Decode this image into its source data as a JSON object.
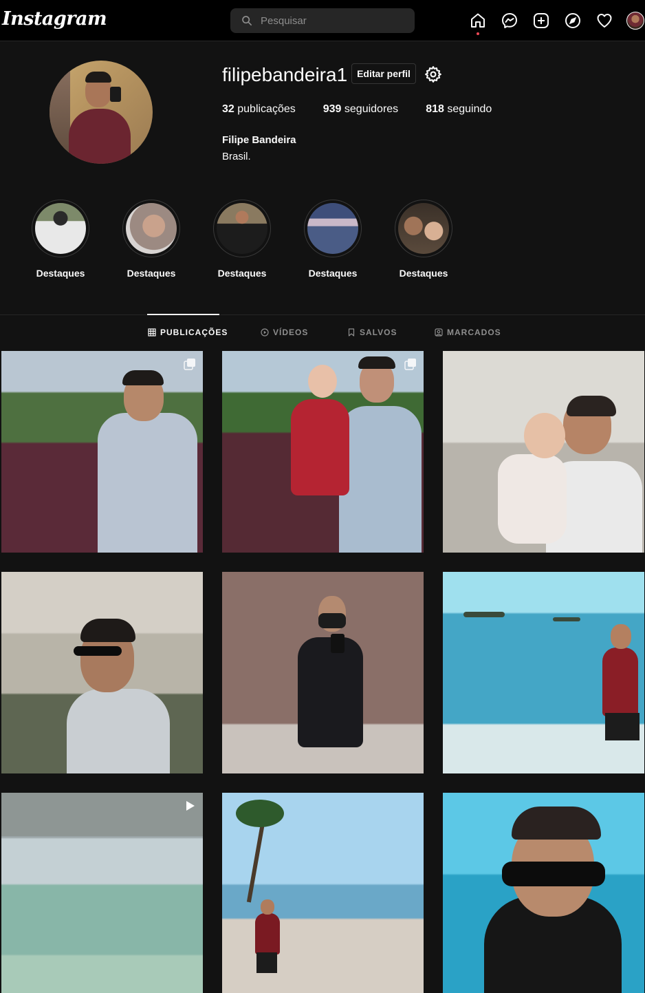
{
  "topbar": {
    "logo": "Instagram",
    "search_placeholder": "Pesquisar",
    "icons": [
      "home-icon",
      "messenger-icon",
      "new-post-icon",
      "explore-icon",
      "activity-heart-icon",
      "profile-avatar"
    ]
  },
  "profile": {
    "username": "filipebandeira1",
    "edit_label": "Editar perfil",
    "posts_count": "32",
    "posts_label": "publicações",
    "followers_count": "939",
    "followers_label": "seguidores",
    "following_count": "818",
    "following_label": "seguindo",
    "full_name": "Filipe Bandeira",
    "bio": "Brasil."
  },
  "highlights": [
    {
      "label": "Destaques"
    },
    {
      "label": "Destaques"
    },
    {
      "label": "Destaques"
    },
    {
      "label": "Destaques"
    },
    {
      "label": "Destaques"
    }
  ],
  "tabs": [
    {
      "label": "PUBLICAÇÕES",
      "icon": "grid-icon",
      "active": true
    },
    {
      "label": "VÍDEOS",
      "icon": "play-circle-icon",
      "active": false
    },
    {
      "label": "SALVOS",
      "icon": "bookmark-icon",
      "active": false
    },
    {
      "label": "MARCADOS",
      "icon": "tagged-user-icon",
      "active": false
    }
  ],
  "posts": [
    {
      "subject": "photo",
      "badge": "carousel-icon"
    },
    {
      "subject": "photo",
      "badge": "carousel-icon"
    },
    {
      "subject": "photo",
      "badge": ""
    },
    {
      "subject": "photo",
      "badge": ""
    },
    {
      "subject": "photo",
      "badge": ""
    },
    {
      "subject": "photo",
      "badge": ""
    },
    {
      "subject": "video",
      "badge": "reel-play-icon"
    },
    {
      "subject": "photo",
      "badge": ""
    },
    {
      "subject": "photo",
      "badge": ""
    }
  ],
  "colors": {
    "background": "#121212",
    "topbar": "#000000",
    "text": "#fafafa",
    "muted": "#8e8e8e",
    "notification_dot": "#ed4956"
  }
}
